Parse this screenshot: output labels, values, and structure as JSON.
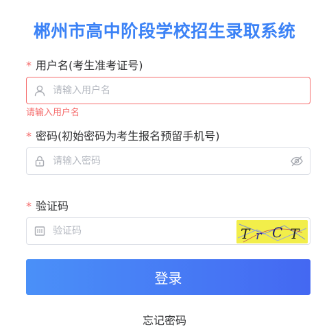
{
  "page": {
    "title": "郴州市高中阶段学校招生录取系统"
  },
  "form": {
    "required_mark": "*",
    "username": {
      "label": "用户名(考生准考证号)",
      "placeholder": "请输入用户名",
      "value": "",
      "error": "请输入用户名",
      "icon": "user-icon"
    },
    "password": {
      "label": "密码(初始密码为考生报名预留手机号)",
      "placeholder": "请输入密码",
      "value": "",
      "icon": "lock-icon",
      "toggle_icon": "eye-off-icon"
    },
    "captcha": {
      "label": "验证码",
      "placeholder": "验证码",
      "value": "",
      "icon": "captcha-icon",
      "image_text": "TrCT"
    },
    "submit_label": "登录",
    "forgot_label": "忘记密码"
  },
  "colors": {
    "title": "#3b82f6",
    "error": "#f56c6c",
    "button_start": "#4a90f8",
    "button_end": "#4468f2",
    "captcha_bg": "#f2ee4a"
  }
}
